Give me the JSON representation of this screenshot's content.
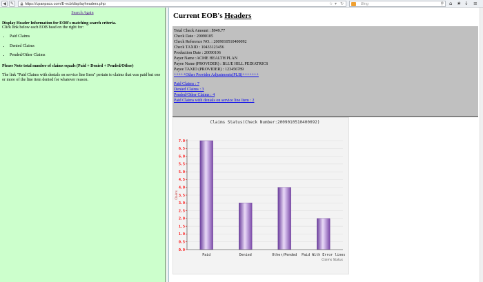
{
  "browser": {
    "url": "https://cpanpacs.com/E-ecb/displayheaders.php",
    "search_placeholder": "Bing"
  },
  "left": {
    "search_again": "Search Again",
    "header": "Display Header Information for EOB's matching search criteria.",
    "instruction": "Click link below each EOB head on the right for:",
    "claim_types": [
      "Paid Claims",
      "Denied Claims",
      "Pended/Other Claims"
    ],
    "note_heading": "Please Note total number of claims equals (Paid + Denied + Pended/Other)",
    "note_text": "The link \"Paid Claims with denials on service line Item\" pertain to claims that was paid but one or more of the line item denied for whatever reason."
  },
  "right": {
    "title_prefix": "Current EOB's ",
    "title_underlined": "Headers",
    "fields": [
      "Total Check Amount : $949.77",
      "Check Date : 20090105",
      "Check Reference NO. : 2009010510400092",
      "Check TAXID : 10433123456",
      "Production Date : 20090106",
      "Payer Name :ACME HEALTH PLAN",
      "Payee Name (PROVIDER) : BLUE HILL PEDIATRICS",
      "Payee TAXID (PROVIDER) : 123456789"
    ],
    "adjustments_link": "+++++Other Provider Adjustments(PLB)+++++++",
    "claim_links": [
      "Paid Claims : 7",
      "Denied Claims : 3",
      "Pended/Other Claims : 4",
      "Paid Claims with denials on service line Item : 2"
    ]
  },
  "chart_data": {
    "type": "bar",
    "title": "Claims Status(Check Number:2009010510400092)",
    "categories": [
      "Paid",
      "Denied",
      "Other/Pended",
      "Paid With Error lines"
    ],
    "values": [
      7,
      3,
      4,
      2
    ],
    "xlabel": "Claims Status",
    "ylabel": "Claims",
    "ylim": [
      0,
      7
    ],
    "yticks": [
      "0.0",
      "0.5",
      "1.0",
      "1.5",
      "2.0",
      "2.5",
      "3.0",
      "3.5",
      "4.0",
      "4.5",
      "5.0",
      "5.5",
      "6.0",
      "6.5",
      "7.0"
    ],
    "grid": true,
    "bar_color": "#9966cc",
    "tick_color": "#ff0000"
  }
}
